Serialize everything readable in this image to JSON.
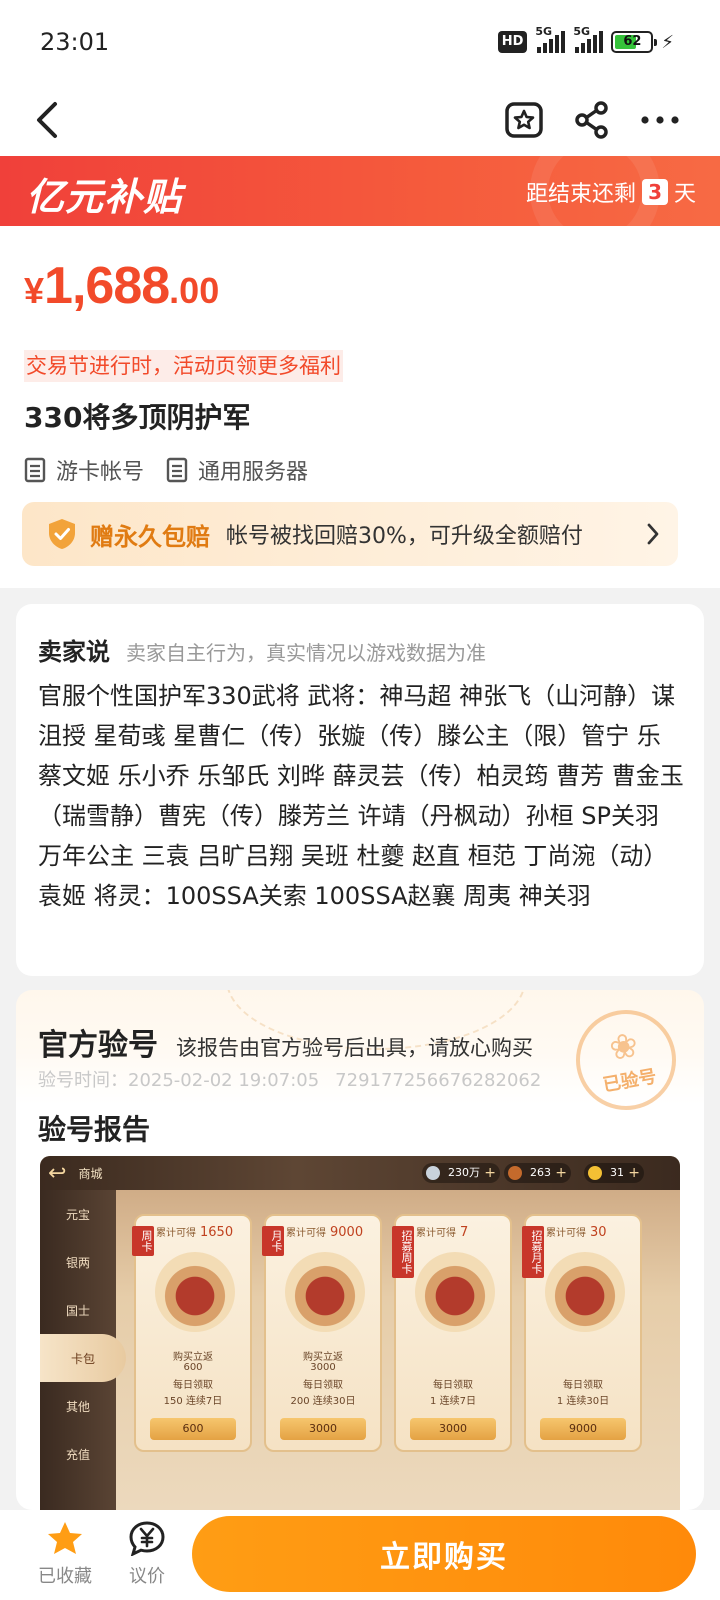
{
  "status_bar": {
    "time": "23:01",
    "hd_label": "HD",
    "net1": "5G",
    "net2": "5G",
    "battery": "62"
  },
  "promo": {
    "logo": "亿元补贴",
    "countdown_prefix": "距结束还剩",
    "days": "3",
    "countdown_suffix": "天"
  },
  "product": {
    "price_currency": "¥",
    "price_int": "1,688",
    "price_dec": ".00",
    "festival": "交易节进行时，活动页领更多福利",
    "title": "330将多顶阴护军",
    "tags": [
      "游卡帐号",
      "通用服务器"
    ],
    "guarantee_title": "赠永久包赔",
    "guarantee_desc": "帐号被找回赔30%，可升级全额赔付"
  },
  "seller": {
    "title": "卖家说",
    "note": "卖家自主行为，真实情况以游戏数据为准",
    "description": "官服个性国护军330武将 武将：神马超 神张飞（山河静）谋沮授 星荀彧 星曹仁（传）张嫙（传）滕公主（限）管宁 乐蔡文姬 乐小乔 乐邹氏 刘晔 薛灵芸（传）柏灵筠 曹芳 曹金玉（瑞雪静）曹宪（传）滕芳兰 许靖（丹枫动）孙桓 SP关羽 万年公主 三袁 吕旷吕翔 吴班 杜夔 赵直 桓范 丁尚涴（动）袁姬 将灵：100SSA关索 100SSA赵襄 周夷 神关羽"
  },
  "verify": {
    "title": "官方验号",
    "desc": "该报告由官方验号后出具，请放心购买",
    "time_label": "验号时间：2025-02-02 19:07:05",
    "serial": "729177256676282062",
    "stamp_text": "已验号",
    "report_title": "验号报告"
  },
  "game_screenshot": {
    "shop_label": "商城",
    "resources": [
      "230万",
      "263",
      "31"
    ],
    "sidebar": [
      "元宝",
      "银两",
      "国士",
      "卡包",
      "其他",
      "充值"
    ],
    "active_sidebar": "卡包",
    "cards": [
      {
        "ribbon": "周卡",
        "accum_label": "累计可得",
        "accum": "1650",
        "buy_label": "购买立返",
        "buy_value": "600",
        "daily_label": "每日领取",
        "daily_value": "150 连续7日",
        "price": "600"
      },
      {
        "ribbon": "月卡",
        "accum_label": "累计可得",
        "accum": "9000",
        "buy_label": "购买立返",
        "buy_value": "3000",
        "daily_label": "每日领取",
        "daily_value": "200 连续30日",
        "price": "3000"
      },
      {
        "ribbon": "招募周卡",
        "accum_label": "累计可得",
        "accum": "7",
        "buy_label": "",
        "buy_value": "",
        "daily_label": "每日领取",
        "daily_value": "1 连续7日",
        "price": "3000"
      },
      {
        "ribbon": "招募月卡",
        "accum_label": "累计可得",
        "accum": "30",
        "buy_label": "",
        "buy_value": "",
        "daily_label": "每日领取",
        "daily_value": "1 连续30日",
        "price": "9000"
      }
    ]
  },
  "bottom_bar": {
    "favorite_label": "已收藏",
    "bargain_label": "议价",
    "buy_label": "立即购买"
  },
  "colors": {
    "brand_red": "#f24a2a",
    "buy_orange": "#ff9d14",
    "favorite_star": "#ff9d14"
  }
}
